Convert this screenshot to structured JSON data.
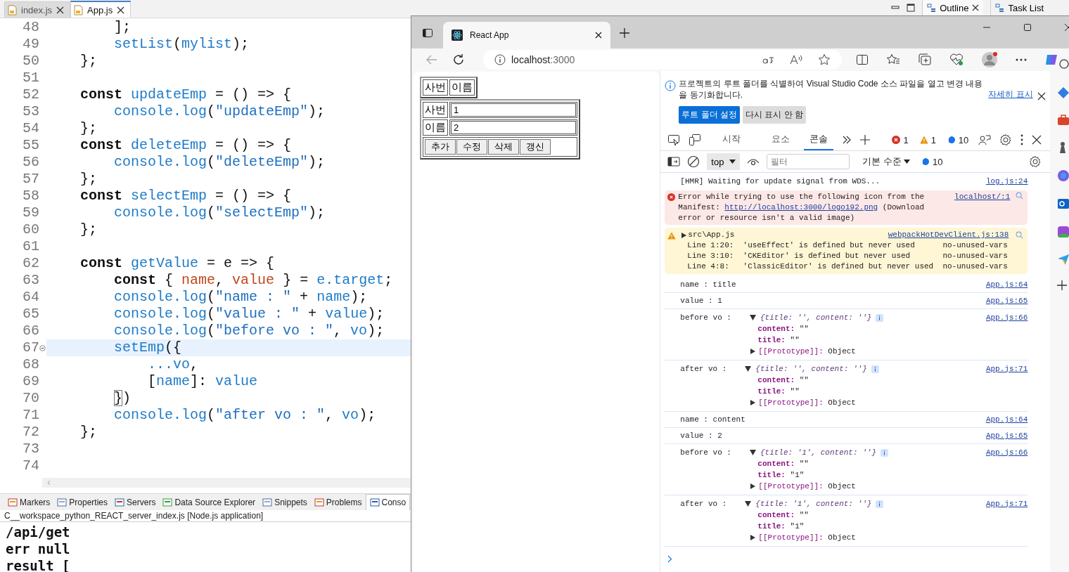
{
  "editor_tabs": [
    {
      "label": "index.js",
      "selected": false
    },
    {
      "label": "App.js",
      "selected": true
    }
  ],
  "side_tabs": [
    {
      "label": "Outline",
      "selected": true
    },
    {
      "label": "Task List",
      "selected": false
    }
  ],
  "code_lines": [
    {
      "number": "48",
      "current": false,
      "fold": false,
      "tokens": [
        {
          "kind": "plain",
          "text": "        ];"
        }
      ]
    },
    {
      "number": "49",
      "current": false,
      "fold": false,
      "tokens": [
        {
          "kind": "fn",
          "text": "        setList"
        },
        {
          "kind": "plain",
          "text": "("
        },
        {
          "kind": "fn",
          "text": "mylist"
        },
        {
          "kind": "plain",
          "text": ");"
        }
      ]
    },
    {
      "number": "50",
      "current": false,
      "fold": false,
      "tokens": [
        {
          "kind": "plain",
          "text": "    };"
        }
      ]
    },
    {
      "number": "51",
      "current": false,
      "fold": false
    },
    {
      "number": "52",
      "current": false,
      "fold": false,
      "tokens": [
        {
          "kind": "kw",
          "text": "    const"
        },
        {
          "kind": "fn",
          "text": " updateEmp"
        },
        {
          "kind": "plain",
          "text": " = () => {"
        }
      ]
    },
    {
      "number": "53",
      "current": false,
      "fold": false,
      "tokens": [
        {
          "kind": "fn",
          "text": "        console.log"
        },
        {
          "kind": "plain",
          "text": "("
        },
        {
          "kind": "str",
          "text": "\"updateEmp\""
        },
        {
          "kind": "plain",
          "text": ");"
        }
      ]
    },
    {
      "number": "54",
      "current": false,
      "fold": false,
      "tokens": [
        {
          "kind": "plain",
          "text": "    };"
        }
      ]
    },
    {
      "number": "55",
      "current": false,
      "fold": false,
      "tokens": [
        {
          "kind": "kw",
          "text": "    const"
        },
        {
          "kind": "fn",
          "text": " deleteEmp"
        },
        {
          "kind": "plain",
          "text": " = () => {"
        }
      ]
    },
    {
      "number": "56",
      "current": false,
      "fold": false,
      "tokens": [
        {
          "kind": "fn",
          "text": "        console.log"
        },
        {
          "kind": "plain",
          "text": "("
        },
        {
          "kind": "str",
          "text": "\"deleteEmp\""
        },
        {
          "kind": "plain",
          "text": ");"
        }
      ]
    },
    {
      "number": "57",
      "current": false,
      "fold": false,
      "tokens": [
        {
          "kind": "plain",
          "text": "    };"
        }
      ]
    },
    {
      "number": "58",
      "current": false,
      "fold": false,
      "tokens": [
        {
          "kind": "kw",
          "text": "    const"
        },
        {
          "kind": "fn",
          "text": " selectEmp"
        },
        {
          "kind": "plain",
          "text": " = () => {"
        }
      ]
    },
    {
      "number": "59",
      "current": false,
      "fold": false,
      "tokens": [
        {
          "kind": "fn",
          "text": "        console.log"
        },
        {
          "kind": "plain",
          "text": "("
        },
        {
          "kind": "str",
          "text": "\"selectEmp\""
        },
        {
          "kind": "plain",
          "text": ");"
        }
      ]
    },
    {
      "number": "60",
      "current": false,
      "fold": false,
      "tokens": [
        {
          "kind": "plain",
          "text": "    };"
        }
      ]
    },
    {
      "number": "61",
      "current": false,
      "fold": false
    },
    {
      "number": "62",
      "current": false,
      "fold": false,
      "tokens": [
        {
          "kind": "kw",
          "text": "    const"
        },
        {
          "kind": "fn",
          "text": " getValue"
        },
        {
          "kind": "plain",
          "text": " = e => {"
        }
      ]
    },
    {
      "number": "63",
      "current": false,
      "fold": false,
      "tokens": [
        {
          "kind": "kw",
          "text": "        const"
        },
        {
          "kind": "plain",
          "text": " { "
        },
        {
          "kind": "var",
          "text": "name"
        },
        {
          "kind": "plain",
          "text": ", "
        },
        {
          "kind": "var",
          "text": "value"
        },
        {
          "kind": "plain",
          "text": " } = "
        },
        {
          "kind": "fn",
          "text": "e.target"
        },
        {
          "kind": "plain",
          "text": ";"
        }
      ]
    },
    {
      "number": "64",
      "current": false,
      "fold": false,
      "tokens": [
        {
          "kind": "fn",
          "text": "        console.log"
        },
        {
          "kind": "plain",
          "text": "("
        },
        {
          "kind": "str",
          "text": "\"name : \""
        },
        {
          "kind": "plain",
          "text": " + "
        },
        {
          "kind": "fn",
          "text": "name"
        },
        {
          "kind": "plain",
          "text": ");"
        }
      ]
    },
    {
      "number": "65",
      "current": false,
      "fold": false,
      "tokens": [
        {
          "kind": "fn",
          "text": "        console.log"
        },
        {
          "kind": "plain",
          "text": "("
        },
        {
          "kind": "str",
          "text": "\"value : \""
        },
        {
          "kind": "plain",
          "text": " + "
        },
        {
          "kind": "fn",
          "text": "value"
        },
        {
          "kind": "plain",
          "text": ");"
        }
      ]
    },
    {
      "number": "66",
      "current": false,
      "fold": false,
      "tokens": [
        {
          "kind": "fn",
          "text": "        console.log"
        },
        {
          "kind": "plain",
          "text": "("
        },
        {
          "kind": "str",
          "text": "\"before vo : \""
        },
        {
          "kind": "plain",
          "text": ", "
        },
        {
          "kind": "fn",
          "text": "vo"
        },
        {
          "kind": "plain",
          "text": ");"
        }
      ]
    },
    {
      "number": "67",
      "current": true,
      "fold": true,
      "tokens": [
        {
          "kind": "fn",
          "text": "        setEmp"
        },
        {
          "kind": "plain",
          "text": "({"
        }
      ]
    },
    {
      "number": "68",
      "current": false,
      "fold": false,
      "tokens": [
        {
          "kind": "fn",
          "text": "            ...vo"
        },
        {
          "kind": "plain",
          "text": ","
        }
      ]
    },
    {
      "number": "69",
      "current": false,
      "fold": false,
      "tokens": [
        {
          "kind": "plain",
          "text": "            ["
        },
        {
          "kind": "fn",
          "text": "name"
        },
        {
          "kind": "plain",
          "text": "]: "
        },
        {
          "kind": "fn",
          "text": "value"
        }
      ]
    },
    {
      "number": "70",
      "current": false,
      "fold": false,
      "tokens": [
        {
          "kind": "bracket",
          "text": "        }"
        },
        {
          "kind": "plain",
          "text": ")"
        }
      ]
    },
    {
      "number": "71",
      "current": false,
      "fold": false,
      "tokens": [
        {
          "kind": "fn",
          "text": "        console.log"
        },
        {
          "kind": "plain",
          "text": "("
        },
        {
          "kind": "str",
          "text": "\"after vo : \""
        },
        {
          "kind": "plain",
          "text": ", "
        },
        {
          "kind": "fn",
          "text": "vo"
        },
        {
          "kind": "plain",
          "text": ");"
        }
      ]
    },
    {
      "number": "72",
      "current": false,
      "fold": false,
      "tokens": [
        {
          "kind": "plain",
          "text": "    };"
        }
      ]
    },
    {
      "number": "73",
      "current": false,
      "fold": false
    },
    {
      "number": "74",
      "current": false,
      "fold": false
    }
  ],
  "bottom_tabs": [
    {
      "label": "Markers",
      "selected": false
    },
    {
      "label": "Properties",
      "selected": false
    },
    {
      "label": "Servers",
      "selected": false
    },
    {
      "label": "Data Source Explorer",
      "selected": false
    },
    {
      "label": "Snippets",
      "selected": false
    },
    {
      "label": "Problems",
      "selected": false
    },
    {
      "label": "Conso",
      "selected": true
    }
  ],
  "console_title": "C__workspace_python_REACT_server_index.js [Node.js application]",
  "console_output": [
    "/api/get",
    "err null",
    "result ["
  ],
  "browser": {
    "tab_title": "React App",
    "url_host": "localhost",
    "url_port": ":3000"
  },
  "page": {
    "header_cells": [
      "사번",
      "이름"
    ],
    "fields": [
      {
        "label": "사번",
        "value": "1"
      },
      {
        "label": "이름",
        "value": "2"
      }
    ],
    "buttons": [
      "추가",
      "수정",
      "삭제",
      "갱신"
    ]
  },
  "devtools": {
    "info_text": "프로젝트의 루트 폴더를 식별하여 Visual Studio Code 소스 파일을 열고 변경 내용을 동기화합니다.",
    "info_link": "자세히 표시",
    "info_buttons": [
      "루트 폴더 설정",
      "다시 표시 안 함"
    ],
    "tabs": [
      {
        "label": "시작",
        "selected": false
      },
      {
        "label": "요소",
        "selected": false
      },
      {
        "label": "콘솔",
        "selected": true
      }
    ],
    "error_count": "1",
    "warning_count": "1",
    "info_count": "10",
    "context": "top",
    "filter_placeholder": "필터",
    "level_menu": "기본 수준",
    "toolbar_info_count": "10",
    "messages": [
      {
        "kind": "log",
        "text": "[HMR] Waiting for update signal from WDS...",
        "source": "log.js:24"
      },
      {
        "kind": "error",
        "text": "Error while trying to use the following icon from the Manifest: ",
        "link": "http://localhost:3000/logo192.png",
        "tail": " (Download error or resource isn't a valid image)",
        "source": "localhost/:1"
      },
      {
        "kind": "warning",
        "text": "src\\App.js",
        "source": "webpackHotDevClient.js:138",
        "lines": [
          "Line 1:20:  'useEffect' is defined but never used      no-unused-vars",
          "Line 3:10:  'CKEditor' is defined but never used       no-unused-vars",
          "Line 4:8:   'ClassicEditor' is defined but never used  no-unused-vars"
        ]
      },
      {
        "kind": "log",
        "text": "name : title",
        "source": "App.js:64"
      },
      {
        "kind": "log",
        "text": "value : 1",
        "source": "App.js:65"
      },
      {
        "kind": "object",
        "text": "before vo :",
        "preview": "{title: '', content: ''}",
        "expanded": true,
        "props": [
          {
            "key": "content:",
            "value": "\"\""
          },
          {
            "key": "title:",
            "value": "\"\""
          }
        ],
        "proto_key": "[[Prototype]]:",
        "proto_value": "Object",
        "source": "App.js:66"
      },
      {
        "kind": "object",
        "text": "after vo :",
        "preview": "{title: '', content: ''}",
        "expanded": true,
        "props": [
          {
            "key": "content:",
            "value": "\"\""
          },
          {
            "key": "title:",
            "value": "\"\""
          }
        ],
        "proto_key": "[[Prototype]]:",
        "proto_value": "Object",
        "source": "App.js:71"
      },
      {
        "kind": "log",
        "text": "name : content",
        "source": "App.js:64"
      },
      {
        "kind": "log",
        "text": "value : 2",
        "source": "App.js:65"
      },
      {
        "kind": "object",
        "text": "before vo :",
        "preview": "{title: '1', content: ''}",
        "expanded": true,
        "props": [
          {
            "key": "content:",
            "value": "\"\""
          },
          {
            "key": "title:",
            "value": "\"1\""
          }
        ],
        "proto_key": "[[Prototype]]:",
        "proto_value": "Object",
        "source": "App.js:66"
      },
      {
        "kind": "object",
        "text": "after vo :",
        "preview": "{title: '1', content: ''}",
        "expanded": true,
        "props": [
          {
            "key": "content:",
            "value": "\"\""
          },
          {
            "key": "title:",
            "value": "\"1\""
          }
        ],
        "proto_key": "[[Prototype]]:",
        "proto_value": "Object",
        "source": "App.js:71"
      }
    ]
  }
}
